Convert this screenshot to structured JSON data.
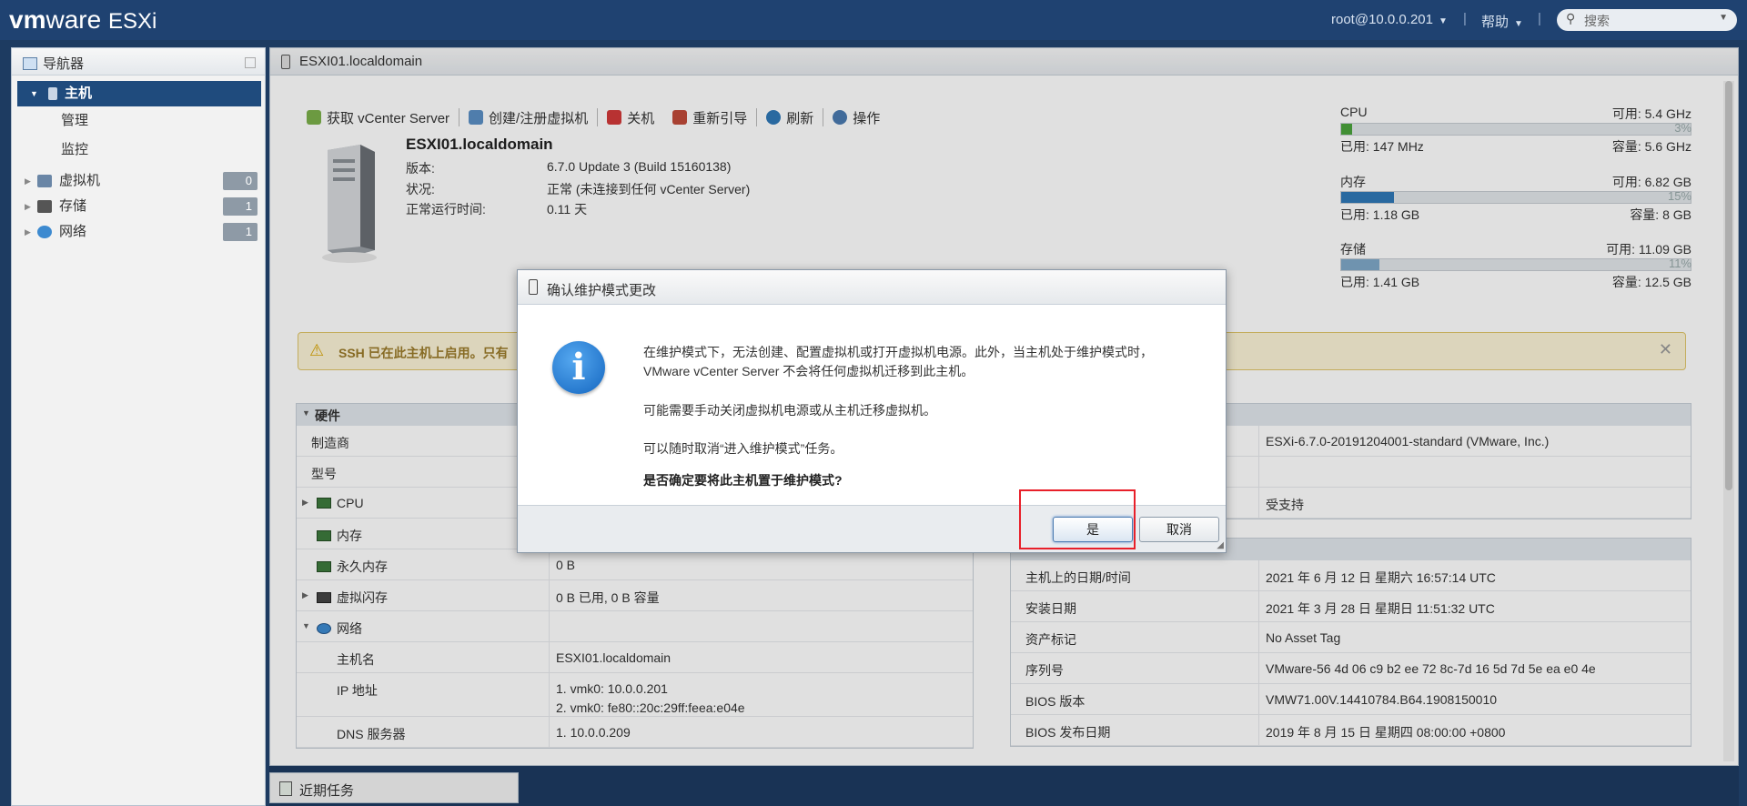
{
  "topbar": {
    "brand_bold": "vm",
    "brand_rest": "ware",
    "product": "ESXi",
    "user": "root@10.0.0.201",
    "help": "帮助",
    "search_placeholder": "搜索"
  },
  "navigator": {
    "title": "导航器",
    "items": [
      {
        "label": "主机",
        "selected": true
      },
      {
        "label": "管理"
      },
      {
        "label": "监控"
      },
      {
        "label": "虚拟机",
        "count": "0"
      },
      {
        "label": "存储",
        "count": "1"
      },
      {
        "label": "网络",
        "count": "1"
      }
    ]
  },
  "main": {
    "title": "ESXI01.localdomain",
    "toolbar": [
      "获取 vCenter Server",
      "创建/注册虚拟机",
      "关机",
      "重新引导",
      "刷新",
      "操作"
    ],
    "host_name": "ESXI01.localdomain",
    "info": [
      {
        "label": "版本:",
        "value": "6.7.0 Update 3 (Build 15160138)"
      },
      {
        "label": "状况:",
        "value": "正常 (未连接到任何 vCenter Server)"
      },
      {
        "label": "正常运行时间:",
        "value": "0.11 天"
      }
    ],
    "resources": [
      {
        "name": "CPU",
        "free": "可用: 5.4 GHz",
        "pct": "3%",
        "fill": 0.03,
        "used": "已用: 147 MHz",
        "cap": "容量: 5.6 GHz",
        "color": "#4aa33c"
      },
      {
        "name": "内存",
        "free": "可用: 6.82 GB",
        "pct": "15%",
        "fill": 0.15,
        "used": "已用: 1.18 GB",
        "cap": "容量: 8 GB",
        "color": "#2f78b7"
      },
      {
        "name": "存储",
        "free": "可用: 11.09 GB",
        "pct": "11%",
        "fill": 0.11,
        "used": "已用: 1.41 GB",
        "cap": "容量: 12.5 GB",
        "color": "#7fa8c8"
      }
    ],
    "alert": "SSH 已在此主机上启用。只有",
    "hardware": {
      "title": "硬件",
      "rows": [
        {
          "k": "制造商",
          "v": ""
        },
        {
          "k": "型号",
          "v": ""
        },
        {
          "k": "CPU",
          "v": ""
        },
        {
          "k": "内存",
          "v": ""
        },
        {
          "k": "永久内存",
          "v": "0 B"
        },
        {
          "k": "虚拟闪存",
          "v": "0 B 已用, 0 B 容量"
        },
        {
          "k": "网络",
          "v": ""
        },
        {
          "k": "主机名",
          "v": "ESXI01.localdomain"
        },
        {
          "k": "IP 地址",
          "v": "1. vmk0: 10.0.0.201",
          "v2": "2. vmk0: fe80::20c:29ff:feea:e04e"
        },
        {
          "k": "DNS 服务器",
          "v": "1. 10.0.0.209"
        }
      ]
    },
    "config_top": [
      {
        "k": "",
        "v": "ESXi-6.7.0-20191204001-standard (VMware, Inc.)"
      },
      {
        "k": "",
        "v": ""
      },
      {
        "k": "",
        "v": "受支持"
      }
    ],
    "system": [
      {
        "k": "主机上的日期/时间",
        "v": "2021 年 6 月 12 日 星期六 16:57:14 UTC"
      },
      {
        "k": "安装日期",
        "v": "2021 年 3 月 28 日 星期日 11:51:32 UTC"
      },
      {
        "k": "资产标记",
        "v": "No Asset Tag"
      },
      {
        "k": "序列号",
        "v": "VMware-56 4d 06 c9 b2 ee 72 8c-7d 16 5d 7d 5e ea e0 4e"
      },
      {
        "k": "BIOS 版本",
        "v": "VMW71.00V.14410784.B64.1908150010"
      },
      {
        "k": "BIOS 发布日期",
        "v": "2019 年 8 月 15 日 星期四 08:00:00 +0800"
      }
    ]
  },
  "tasks": {
    "label": "近期任务"
  },
  "dialog": {
    "title": "确认维护模式更改",
    "line1": "在维护模式下，无法创建、配置虚拟机或打开虚拟机电源。此外，当主机处于维护模式时，",
    "line2": "VMware vCenter Server 不会将任何虚拟机迁移到此主机。",
    "line3": "可能需要手动关闭虚拟机电源或从主机迁移虚拟机。",
    "line4": "可以随时取消“进入维护模式”任务。",
    "question": "是否确定要将此主机置于维护模式?",
    "yes": "是",
    "cancel": "取消"
  }
}
